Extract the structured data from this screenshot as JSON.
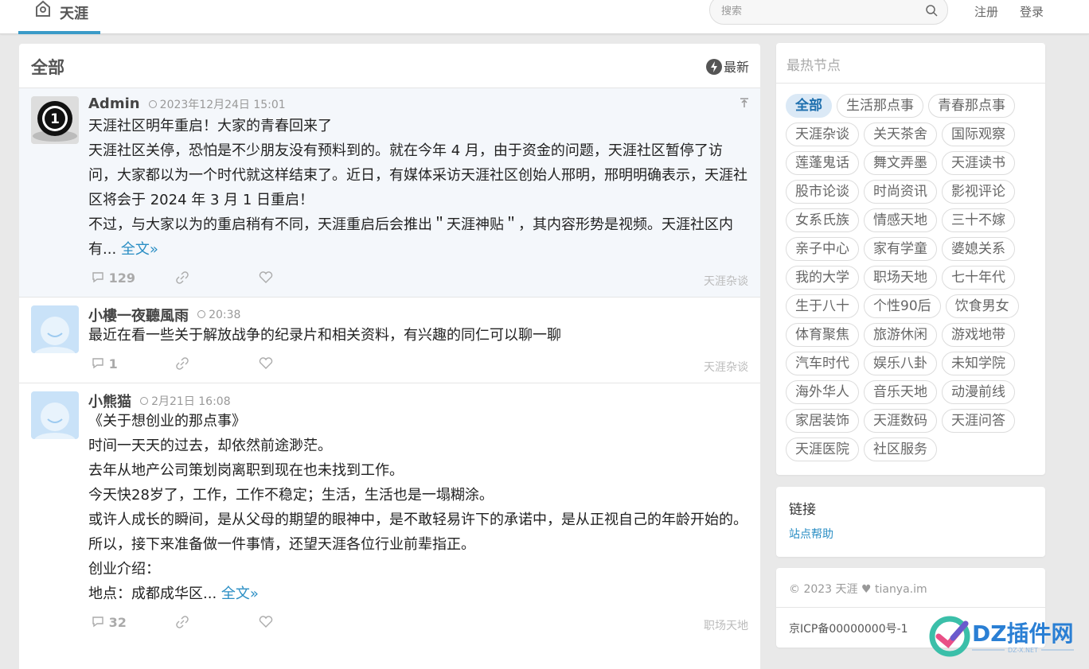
{
  "header": {
    "site_name": "天涯",
    "search_placeholder": "搜索",
    "register": "注册",
    "login": "登录"
  },
  "main": {
    "title": "全部",
    "sort_label": "最新",
    "posts": [
      {
        "author": "Admin",
        "time": "2023年12月24日 15:01",
        "pinned_icon": "pin-icon",
        "paragraphs": [
          "天涯社区明年重启！大家的青春回来了",
          "天涯社区关停，恐怕是不少朋友没有预料到的。就在今年 4 月，由于资金的问题，天涯社区暂停了访问，大家都以为一个时代就这样结束了。近日，有媒体采访天涯社区创始人邢明，邢明明确表示，天涯社区将会于 2024 年 3 月 1 日重启！",
          "不过，与大家以为的重启稍有不同，天涯重启后会推出＂天涯神贴＂，其内容形势是视频。天涯社区内有..."
        ],
        "more": "全文»",
        "comments": "129",
        "node": "天涯杂谈"
      },
      {
        "author": "小樓一夜聽風雨",
        "time": "20:38",
        "paragraphs": [
          "最近在看一些关于解放战争的纪录片和相关资料，有兴趣的同仁可以聊一聊"
        ],
        "more": "",
        "comments": "1",
        "node": "天涯杂谈"
      },
      {
        "author": "小熊猫",
        "time": "2月21日 16:08",
        "paragraphs": [
          "《关于想创业的那点事》",
          "时间一天天的过去，却依然前途渺茫。",
          "去年从地产公司策划岗离职到现在也未找到工作。",
          "今天快28岁了，工作，工作不稳定；生活，生活也是一塌糊涂。",
          "或许人成长的瞬间，是从父母的期望的眼神中，是不敢轻易许下的承诺中，是从正视自己的年龄开始的。",
          "所以，接下来准备做一件事情，还望天涯各位行业前辈指正。",
          "创业介绍：",
          "地点：成都成华区..."
        ],
        "more": "全文»",
        "comments": "32",
        "node": "职场天地"
      }
    ]
  },
  "sidebar": {
    "hot_title": "最热节点",
    "tags": [
      "全部",
      "生活那点事",
      "青春那点事",
      "天涯杂谈",
      "关天茶舍",
      "国际观察",
      "莲蓬鬼话",
      "舞文弄墨",
      "天涯读书",
      "股市论谈",
      "时尚资讯",
      "影视评论",
      "女系氏族",
      "情感天地",
      "三十不嫁",
      "亲子中心",
      "家有学童",
      "婆媳关系",
      "我的大学",
      "职场天地",
      "七十年代",
      "生于八十",
      "个性90后",
      "饮食男女",
      "体育聚焦",
      "旅游休闲",
      "游戏地带",
      "汽车时代",
      "娱乐八卦",
      "未知学院",
      "海外华人",
      "音乐天地",
      "动漫前线",
      "家居装饰",
      "天涯数码",
      "天涯问答",
      "天涯医院",
      "社区服务"
    ],
    "links_title": "链接",
    "links": [
      "站点帮助"
    ],
    "copyright": "© 2023 天涯 ♥ tianya.im",
    "icp": "京ICP备00000000号-1"
  },
  "watermark": {
    "text": "DZ插件网",
    "sub": "DZ-X.NET"
  },
  "colors": {
    "accent": "#3a9bc8",
    "link": "#2a8ec4",
    "active_tag_bg": "#dbe9f6"
  }
}
